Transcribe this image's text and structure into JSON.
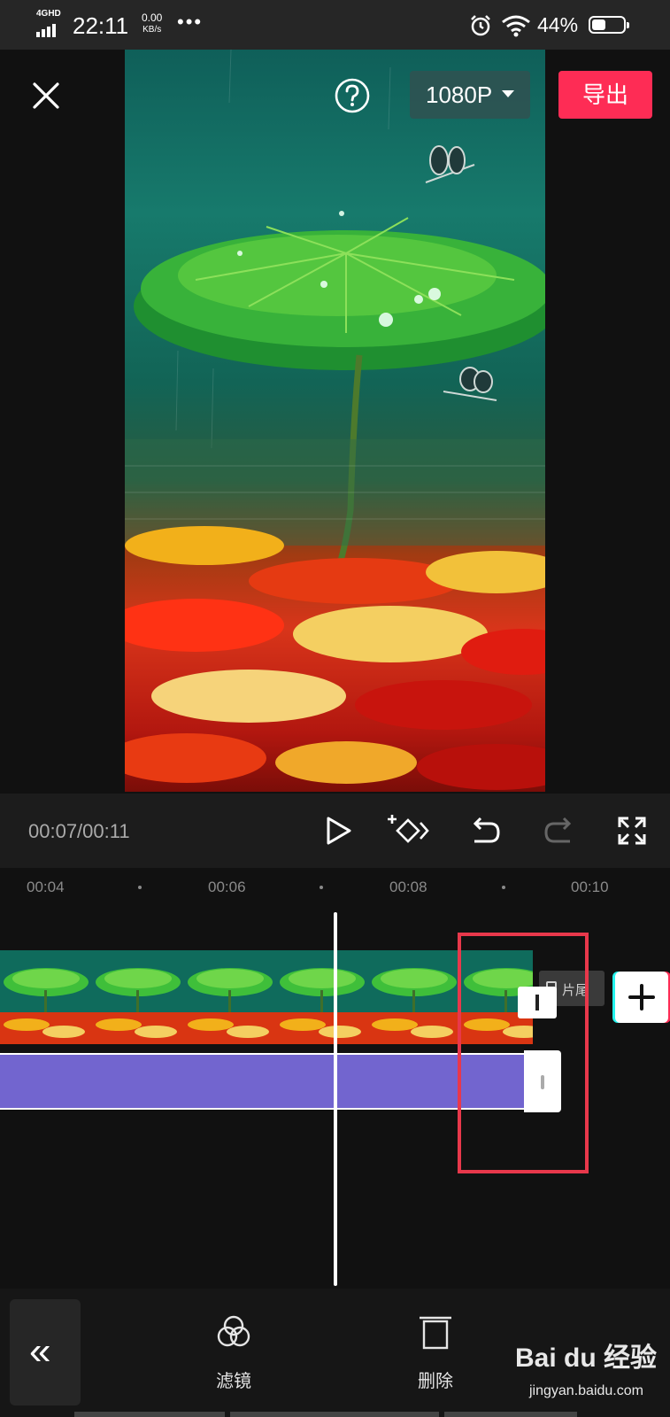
{
  "status_bar": {
    "network": "4GHD",
    "time": "22:11",
    "speed_value": "0.00",
    "speed_unit": "KB/s",
    "more": "•••",
    "battery": "44%",
    "battery_level": 0.44
  },
  "toolbar": {
    "resolution": "1080P",
    "export_label": "导出"
  },
  "player": {
    "timecode": "00:07/00:11"
  },
  "ruler": {
    "ticks": [
      "00:04",
      "00:06",
      "00:08",
      "00:10"
    ]
  },
  "timeline": {
    "tail_label": "片尾"
  },
  "bottom_tools": {
    "filter": "滤镜",
    "delete": "删除"
  },
  "watermark": {
    "brand": "Bai du 经验",
    "site": "jingyan.baidu.com"
  },
  "colors": {
    "accent": "#fe2c55",
    "audio_track": "#7265cf",
    "highlight": "#e8384b"
  }
}
